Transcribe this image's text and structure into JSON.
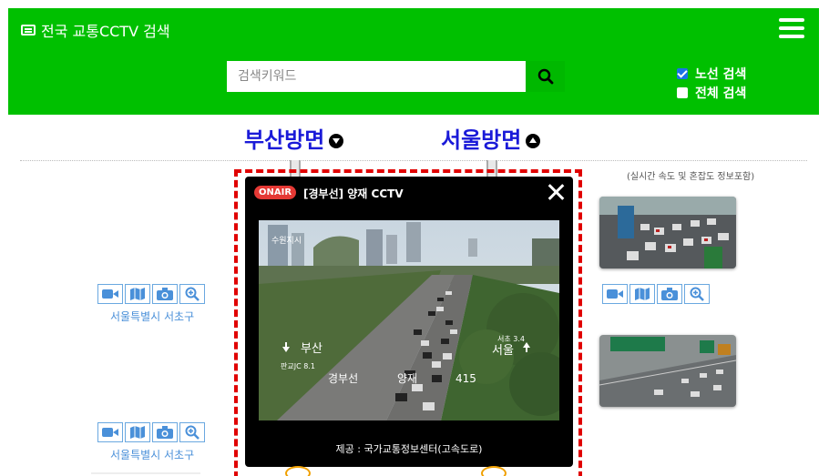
{
  "header": {
    "title": "전국 교통CCTV 검색",
    "search_placeholder": "검색키워드",
    "options": [
      {
        "label": "노선 검색",
        "checked": true
      },
      {
        "label": "전체 검색",
        "checked": false
      }
    ]
  },
  "directions": {
    "left": "부산방면",
    "right": "서울방면"
  },
  "info_note": "(실시간 속도 및 혼잡도 정보포함)",
  "left_cams": [
    {
      "location": "서울특별시 서초구"
    },
    {
      "location": "서울특별시 서초구"
    }
  ],
  "popup": {
    "badge": "ONAIR",
    "title": "[경부선] 양재 CCTV",
    "credit": "제공 : 국가교통정보센터(고속도로)",
    "overlay": {
      "top_left": "수원지시",
      "busan": "부산",
      "jc": "판교JC 8.1",
      "gyeongbu": "경부선",
      "yangjae": "양재",
      "num": "415",
      "seocho": "서초 3.4",
      "seoul": "서울"
    }
  },
  "colors": {
    "header_bg": "#00c000",
    "direction_text": "#1a1ad8",
    "popup_border": "#e00000",
    "onair": "#e53935"
  }
}
